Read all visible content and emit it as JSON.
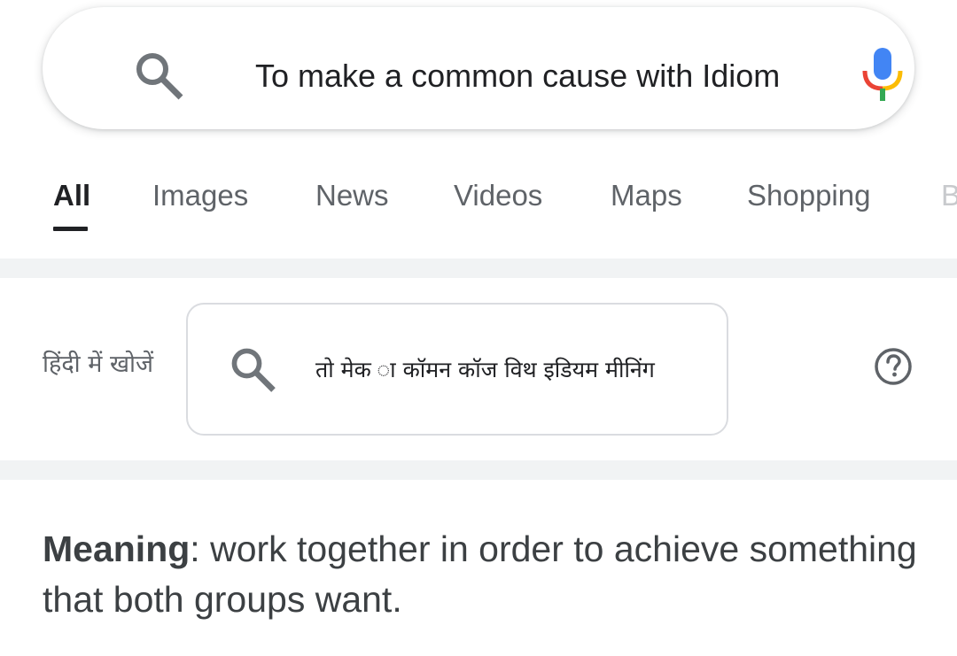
{
  "search": {
    "query": "To make a common cause with  Idiom"
  },
  "icons": {
    "search": "search-icon",
    "mic": "mic-icon",
    "help": "help-circle-icon"
  },
  "colors": {
    "mic_blue": "#4285F4",
    "mic_red": "#EA4335",
    "mic_yellow": "#FBBC05",
    "mic_green": "#34A853",
    "icon_gray": "#70757a",
    "divider": "#f1f3f4"
  },
  "tabs": [
    {
      "label": "All",
      "active": true
    },
    {
      "label": "Images",
      "active": false
    },
    {
      "label": "News",
      "active": false
    },
    {
      "label": "Videos",
      "active": false
    },
    {
      "label": "Maps",
      "active": false
    },
    {
      "label": "Shopping",
      "active": false
    },
    {
      "label": "B",
      "active": false
    }
  ],
  "hindi": {
    "label": "हिंदी में खोजें",
    "query": "तो मेक ा कॉमन कॉज विथ इडियम मीनिंग"
  },
  "meaning": {
    "term": "Meaning",
    "definition": ": work together in order to achieve something that both groups want."
  }
}
